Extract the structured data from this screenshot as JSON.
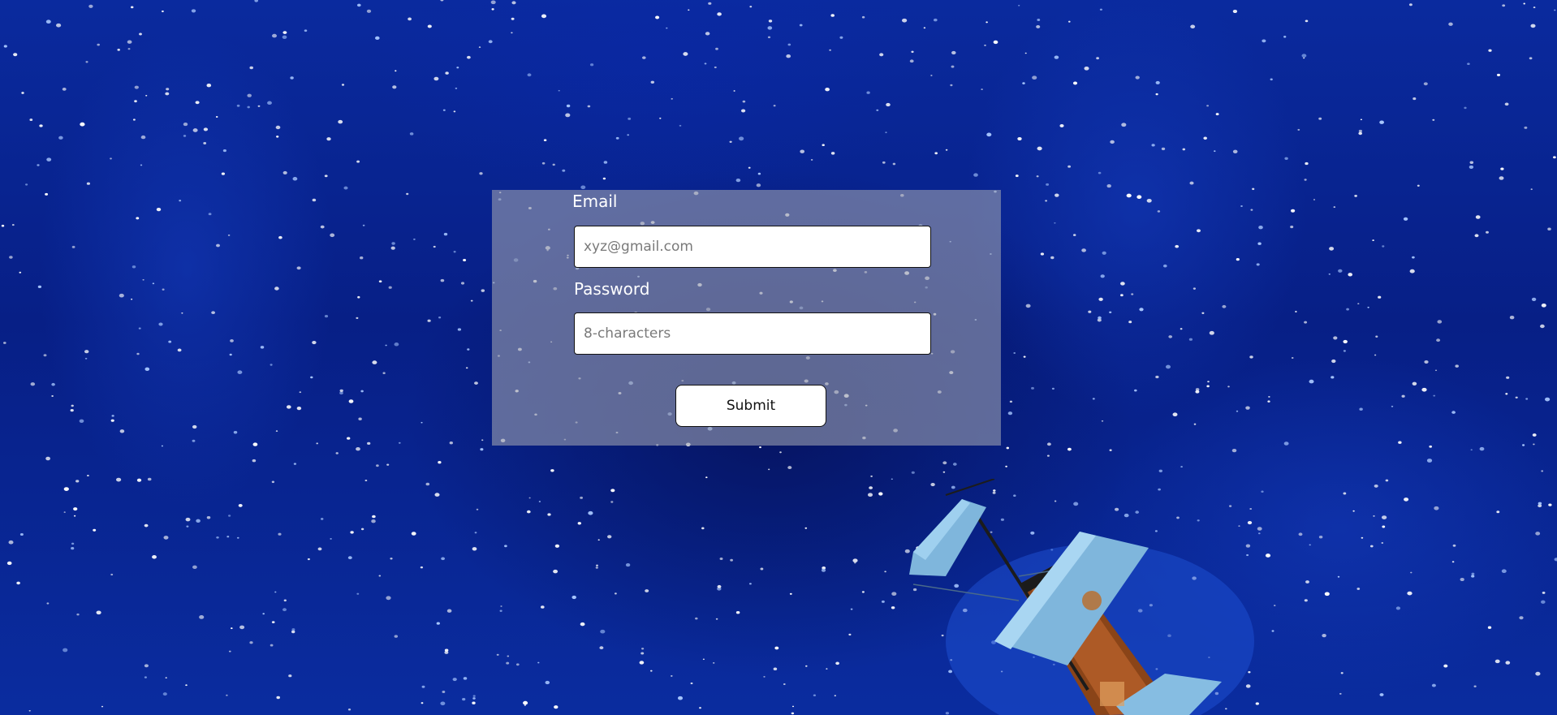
{
  "login_form": {
    "email_label": "Email",
    "email_placeholder": "xyz@gmail.com",
    "email_value": "",
    "password_label": "Password",
    "password_placeholder": "8-characters",
    "password_value": "",
    "submit_label": "Submit"
  },
  "colors": {
    "background_blue": "#0a2a9e",
    "card_overlay": "#969bafa0",
    "sail_blue": "#7fb6dc",
    "hull_brown": "#8a4418"
  },
  "icons": {
    "background": "starry-night-sky",
    "illustration": "flying-sail-ship"
  }
}
